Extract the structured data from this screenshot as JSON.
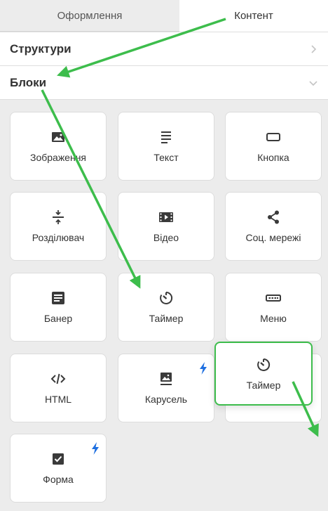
{
  "tabs": [
    {
      "label": "Оформлення",
      "active": false
    },
    {
      "label": "Контент",
      "active": true
    }
  ],
  "sections": {
    "structures": {
      "label": "Структури",
      "expanded": false
    },
    "blocks": {
      "label": "Блоки",
      "expanded": true
    }
  },
  "blocks": [
    {
      "label": "Зображення",
      "icon": "image-icon"
    },
    {
      "label": "Текст",
      "icon": "text-icon"
    },
    {
      "label": "Кнопка",
      "icon": "button-icon"
    },
    {
      "label": "Розділювач",
      "icon": "divider-icon"
    },
    {
      "label": "Відео",
      "icon": "video-icon"
    },
    {
      "label": "Соц. мережі",
      "icon": "share-icon"
    },
    {
      "label": "Банер",
      "icon": "banner-icon"
    },
    {
      "label": "Таймер",
      "icon": "timer-icon"
    },
    {
      "label": "Меню",
      "icon": "menu-icon"
    },
    {
      "label": "HTML",
      "icon": "code-icon"
    },
    {
      "label": "Карусель",
      "icon": "carousel-icon",
      "badge": "bolt-icon"
    },
    {
      "label": "Форма",
      "icon": "form-icon",
      "badge": "bolt-icon"
    }
  ],
  "dragging": {
    "label": "Таймер",
    "icon": "timer-icon"
  },
  "colors": {
    "accent_green": "#3dbd4c",
    "bolt_blue": "#1e6fe0",
    "icon_dark": "#3a3a3a"
  }
}
